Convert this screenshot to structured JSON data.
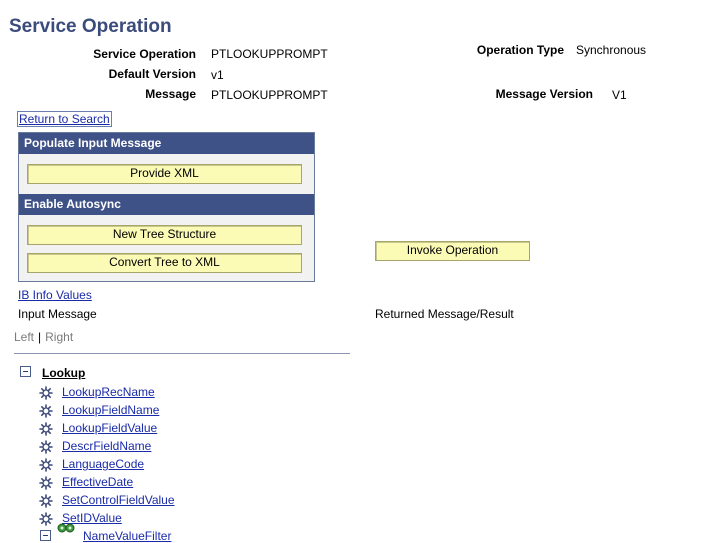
{
  "page_title": "Service Operation",
  "fields": {
    "service_operation_label": "Service Operation",
    "service_operation_value": "PTLOOKUPPROMPT",
    "default_version_label": "Default Version",
    "default_version_value": "v1",
    "message_label": "Message",
    "message_value": "PTLOOKUPPROMPT",
    "operation_type_label": "Operation Type",
    "operation_type_value": "Synchronous",
    "message_version_label": "Message Version",
    "message_version_value": "V1"
  },
  "return_to_search": "Return to Search",
  "panel": {
    "populate_header": "Populate Input Message",
    "provide_xml": "Provide XML",
    "autosync_header": "Enable Autosync",
    "new_tree_structure": "New Tree Structure",
    "convert_tree_to_xml": "Convert Tree to XML"
  },
  "invoke_operation": "Invoke Operation",
  "ib_info_values": "IB Info Values",
  "input_message": "Input Message",
  "returned_message": "Returned Message/Result",
  "tabs": {
    "left": "Left",
    "right": "Right"
  },
  "tree": {
    "root": "Lookup",
    "items": [
      "LookupRecName",
      "LookupFieldName",
      "LookupFieldValue",
      "DescrFieldName",
      "LanguageCode",
      "EffectiveDate",
      "SetControlFieldValue",
      "SetIDValue"
    ],
    "partial": "NameValueFilter"
  },
  "colors": {
    "header_blue": "#3f5288",
    "button_yellow": "#fbfbb6",
    "title_blue": "#3b4c7c",
    "link_blue": "#1a2ba8"
  }
}
